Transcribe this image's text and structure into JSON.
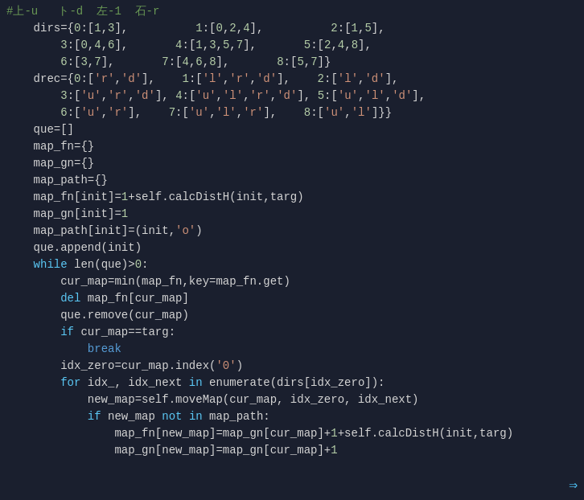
{
  "header": {
    "text": "#上-u   ト-d  左-1  石-r"
  },
  "lines": [
    {
      "id": "line-header",
      "indent": "",
      "tokens": [
        {
          "text": "#上-u   ト-d  左-1  石-r",
          "class": "c-comment"
        }
      ]
    },
    {
      "id": "line-dirs1",
      "indent": "    ",
      "tokens": [
        {
          "text": "dirs=",
          "class": "c-light"
        },
        {
          "text": "{",
          "class": "c-light"
        },
        {
          "text": "0",
          "class": "c-number"
        },
        {
          "text": ":[",
          "class": "c-light"
        },
        {
          "text": "1",
          "class": "c-number"
        },
        {
          "text": ",",
          "class": "c-light"
        },
        {
          "text": "3",
          "class": "c-number"
        },
        {
          "text": "],",
          "class": "c-light"
        },
        {
          "text": "          1",
          "class": "c-light c-number"
        },
        {
          "text": ":[",
          "class": "c-light"
        },
        {
          "text": "0",
          "class": "c-number"
        },
        {
          "text": ",",
          "class": "c-light"
        },
        {
          "text": "2",
          "class": "c-number"
        },
        {
          "text": ",",
          "class": "c-light"
        },
        {
          "text": "4",
          "class": "c-number"
        },
        {
          "text": "],",
          "class": "c-light"
        },
        {
          "text": "          2",
          "class": "c-light"
        },
        {
          "text": ":[",
          "class": "c-light"
        },
        {
          "text": "1",
          "class": "c-number"
        },
        {
          "text": ",",
          "class": "c-light"
        },
        {
          "text": "5",
          "class": "c-number"
        },
        {
          "text": "],",
          "class": "c-light"
        }
      ]
    },
    {
      "id": "line-dirs2",
      "indent": "        ",
      "tokens": [
        {
          "text": "3",
          "class": "c-number"
        },
        {
          "text": ":[",
          "class": "c-light"
        },
        {
          "text": "0",
          "class": "c-number"
        },
        {
          "text": ",",
          "class": "c-light"
        },
        {
          "text": "4",
          "class": "c-number"
        },
        {
          "text": ",",
          "class": "c-light"
        },
        {
          "text": "6",
          "class": "c-number"
        },
        {
          "text": "],",
          "class": "c-light"
        },
        {
          "text": "       4",
          "class": "c-light"
        },
        {
          "text": ":[",
          "class": "c-light"
        },
        {
          "text": "1",
          "class": "c-number"
        },
        {
          "text": ",",
          "class": "c-light"
        },
        {
          "text": "3",
          "class": "c-number"
        },
        {
          "text": ",",
          "class": "c-light"
        },
        {
          "text": "5",
          "class": "c-number"
        },
        {
          "text": ",",
          "class": "c-light"
        },
        {
          "text": "7",
          "class": "c-number"
        },
        {
          "text": "],",
          "class": "c-light"
        },
        {
          "text": "       5",
          "class": "c-light"
        },
        {
          "text": ":[",
          "class": "c-light"
        },
        {
          "text": "2",
          "class": "c-number"
        },
        {
          "text": ",",
          "class": "c-light"
        },
        {
          "text": "4",
          "class": "c-number"
        },
        {
          "text": ",",
          "class": "c-light"
        },
        {
          "text": "8",
          "class": "c-number"
        },
        {
          "text": "],",
          "class": "c-light"
        }
      ]
    },
    {
      "id": "line-dirs3",
      "tokens": [
        {
          "text": "        6",
          "class": "c-light"
        },
        {
          "text": ":[",
          "class": "c-light"
        },
        {
          "text": "3",
          "class": "c-number"
        },
        {
          "text": ",",
          "class": "c-light"
        },
        {
          "text": "7",
          "class": "c-number"
        },
        {
          "text": "],",
          "class": "c-light"
        },
        {
          "text": "       7",
          "class": "c-light"
        },
        {
          "text": ":[",
          "class": "c-light"
        },
        {
          "text": "4",
          "class": "c-number"
        },
        {
          "text": ",",
          "class": "c-light"
        },
        {
          "text": "6",
          "class": "c-number"
        },
        {
          "text": ",",
          "class": "c-light"
        },
        {
          "text": "8",
          "class": "c-number"
        },
        {
          "text": "],",
          "class": "c-light"
        },
        {
          "text": "       8",
          "class": "c-light"
        },
        {
          "text": ":[",
          "class": "c-light"
        },
        {
          "text": "5",
          "class": "c-number"
        },
        {
          "text": ",",
          "class": "c-light"
        },
        {
          "text": "7",
          "class": "c-number"
        },
        {
          "text": "]}",
          "class": "c-light"
        }
      ]
    },
    {
      "id": "line-drec1",
      "tokens": [
        {
          "text": "    drec=",
          "class": "c-light"
        },
        {
          "text": "{",
          "class": "c-light"
        },
        {
          "text": "0",
          "class": "c-number"
        },
        {
          "text": ":[",
          "class": "c-light"
        },
        {
          "text": "'r'",
          "class": "c-string"
        },
        {
          "text": ",",
          "class": "c-light"
        },
        {
          "text": "'d'",
          "class": "c-string"
        },
        {
          "text": "],",
          "class": "c-light"
        },
        {
          "text": "    1",
          "class": "c-light"
        },
        {
          "text": ":[",
          "class": "c-light"
        },
        {
          "text": "'l'",
          "class": "c-string"
        },
        {
          "text": ",",
          "class": "c-light"
        },
        {
          "text": "'r'",
          "class": "c-string"
        },
        {
          "text": ",",
          "class": "c-light"
        },
        {
          "text": "'d'",
          "class": "c-string"
        },
        {
          "text": "],",
          "class": "c-light"
        },
        {
          "text": "    2",
          "class": "c-light"
        },
        {
          "text": ":[",
          "class": "c-light"
        },
        {
          "text": "'l'",
          "class": "c-string"
        },
        {
          "text": ",",
          "class": "c-light"
        },
        {
          "text": "'d'",
          "class": "c-string"
        },
        {
          "text": "],",
          "class": "c-light"
        }
      ]
    },
    {
      "id": "line-drec2",
      "tokens": [
        {
          "text": "        3",
          "class": "c-light"
        },
        {
          "text": ":[",
          "class": "c-light"
        },
        {
          "text": "'u'",
          "class": "c-string"
        },
        {
          "text": ",",
          "class": "c-light"
        },
        {
          "text": "'r'",
          "class": "c-string"
        },
        {
          "text": ",",
          "class": "c-light"
        },
        {
          "text": "'d'",
          "class": "c-string"
        },
        {
          "text": "], 4",
          "class": "c-light"
        },
        {
          "text": ":[",
          "class": "c-light"
        },
        {
          "text": "'u'",
          "class": "c-string"
        },
        {
          "text": ",",
          "class": "c-light"
        },
        {
          "text": "'l'",
          "class": "c-string"
        },
        {
          "text": ",",
          "class": "c-light"
        },
        {
          "text": "'r'",
          "class": "c-string"
        },
        {
          "text": ",",
          "class": "c-light"
        },
        {
          "text": "'d'",
          "class": "c-string"
        },
        {
          "text": "], 5",
          "class": "c-light"
        },
        {
          "text": ":[",
          "class": "c-light"
        },
        {
          "text": "'u'",
          "class": "c-string"
        },
        {
          "text": ",",
          "class": "c-light"
        },
        {
          "text": "'l'",
          "class": "c-string"
        },
        {
          "text": ",",
          "class": "c-light"
        },
        {
          "text": "'d'",
          "class": "c-string"
        },
        {
          "text": "],",
          "class": "c-light"
        }
      ]
    },
    {
      "id": "line-drec3",
      "tokens": [
        {
          "text": "        6",
          "class": "c-light"
        },
        {
          "text": ":[",
          "class": "c-light"
        },
        {
          "text": "'u'",
          "class": "c-string"
        },
        {
          "text": ",",
          "class": "c-light"
        },
        {
          "text": "'r'",
          "class": "c-string"
        },
        {
          "text": "],",
          "class": "c-light"
        },
        {
          "text": "    7",
          "class": "c-light"
        },
        {
          "text": ":[",
          "class": "c-light"
        },
        {
          "text": "'u'",
          "class": "c-string"
        },
        {
          "text": ",",
          "class": "c-light"
        },
        {
          "text": "'l'",
          "class": "c-string"
        },
        {
          "text": ",",
          "class": "c-light"
        },
        {
          "text": "'r'",
          "class": "c-string"
        },
        {
          "text": "],",
          "class": "c-light"
        },
        {
          "text": "    8",
          "class": "c-light"
        },
        {
          "text": ":[",
          "class": "c-light"
        },
        {
          "text": "'u'",
          "class": "c-string"
        },
        {
          "text": ",",
          "class": "c-light"
        },
        {
          "text": "'l'",
          "class": "c-string"
        },
        {
          "text": "]}}",
          "class": "c-light"
        }
      ]
    },
    {
      "id": "line-que",
      "tokens": [
        {
          "text": "    que=[]",
          "class": "c-light"
        }
      ]
    },
    {
      "id": "line-mapfn",
      "tokens": [
        {
          "text": "    map_fn={}",
          "class": "c-light"
        }
      ]
    },
    {
      "id": "line-mapgn",
      "tokens": [
        {
          "text": "    map_gn={}",
          "class": "c-light"
        }
      ]
    },
    {
      "id": "line-mappath",
      "tokens": [
        {
          "text": "    map_path={}",
          "class": "c-light"
        }
      ]
    },
    {
      "id": "line-mapfninit",
      "tokens": [
        {
          "text": "    map_fn[init]=",
          "class": "c-light"
        },
        {
          "text": "1",
          "class": "c-number"
        },
        {
          "text": "+self.calcDistH(init,targ)",
          "class": "c-light"
        }
      ]
    },
    {
      "id": "line-mapgninit",
      "tokens": [
        {
          "text": "    map_gn[init]=",
          "class": "c-light"
        },
        {
          "text": "1",
          "class": "c-number"
        }
      ]
    },
    {
      "id": "line-mappathinit",
      "tokens": [
        {
          "text": "    map_path[init]=(init,",
          "class": "c-light"
        },
        {
          "text": "'o'",
          "class": "c-string"
        },
        {
          "text": ")",
          "class": "c-light"
        }
      ]
    },
    {
      "id": "line-queappend",
      "tokens": [
        {
          "text": "    que.append(init)",
          "class": "c-light"
        }
      ]
    },
    {
      "id": "line-while",
      "tokens": [
        {
          "text": "    ",
          "class": "c-light"
        },
        {
          "text": "while",
          "class": "c-keyword"
        },
        {
          "text": " len(que)>",
          "class": "c-light"
        },
        {
          "text": "0",
          "class": "c-number"
        },
        {
          "text": ":",
          "class": "c-light"
        }
      ]
    },
    {
      "id": "line-curmap",
      "tokens": [
        {
          "text": "        cur_map=min(map_fn,key=map_fn.get)",
          "class": "c-light"
        }
      ]
    },
    {
      "id": "line-del",
      "tokens": [
        {
          "text": "        ",
          "class": "c-light"
        },
        {
          "text": "del",
          "class": "c-keyword"
        },
        {
          "text": " map_fn[cur_map]",
          "class": "c-light"
        }
      ]
    },
    {
      "id": "line-queremove",
      "tokens": [
        {
          "text": "        que.remove(cur_map)",
          "class": "c-light"
        }
      ]
    },
    {
      "id": "line-if",
      "tokens": [
        {
          "text": "        ",
          "class": "c-light"
        },
        {
          "text": "if",
          "class": "c-keyword"
        },
        {
          "text": " cur_map==targ:",
          "class": "c-light"
        }
      ]
    },
    {
      "id": "line-break",
      "tokens": [
        {
          "text": "            ",
          "class": "c-light"
        },
        {
          "text": "break",
          "class": "c-break"
        }
      ]
    },
    {
      "id": "line-idxzero",
      "tokens": [
        {
          "text": "        idx_zero=cur_map.index(",
          "class": "c-light"
        },
        {
          "text": "'0'",
          "class": "c-string"
        },
        {
          "text": ")",
          "class": "c-light"
        }
      ]
    },
    {
      "id": "line-for",
      "tokens": [
        {
          "text": "        ",
          "class": "c-light"
        },
        {
          "text": "for",
          "class": "c-keyword"
        },
        {
          "text": " idx_, idx_next ",
          "class": "c-light"
        },
        {
          "text": "in",
          "class": "c-keyword"
        },
        {
          "text": " enumerate(dirs[idx_zero]):",
          "class": "c-light"
        }
      ]
    },
    {
      "id": "line-newmap",
      "tokens": [
        {
          "text": "            new_map=self.moveMap(cur_map, idx_zero, idx_next)",
          "class": "c-light"
        }
      ]
    },
    {
      "id": "line-ifnewmap",
      "tokens": [
        {
          "text": "            ",
          "class": "c-light"
        },
        {
          "text": "if",
          "class": "c-keyword"
        },
        {
          "text": " new_map ",
          "class": "c-light"
        },
        {
          "text": "not",
          "class": "c-keyword"
        },
        {
          "text": " ",
          "class": "c-light"
        },
        {
          "text": "in",
          "class": "c-keyword"
        },
        {
          "text": " map_path:",
          "class": "c-light"
        }
      ]
    },
    {
      "id": "line-mapfnnewmap",
      "tokens": [
        {
          "text": "                map_fn[new_map]=map_gn[cur_map]+",
          "class": "c-light"
        },
        {
          "text": "1",
          "class": "c-number"
        },
        {
          "text": "+self.calcDistH(init,targ)",
          "class": "c-light"
        }
      ]
    },
    {
      "id": "line-mapgnnewmap",
      "tokens": [
        {
          "text": "                map_gn[new_map]=map_gn[cur_map]+",
          "class": "c-light"
        },
        {
          "text": "1",
          "class": "c-number"
        }
      ]
    }
  ]
}
